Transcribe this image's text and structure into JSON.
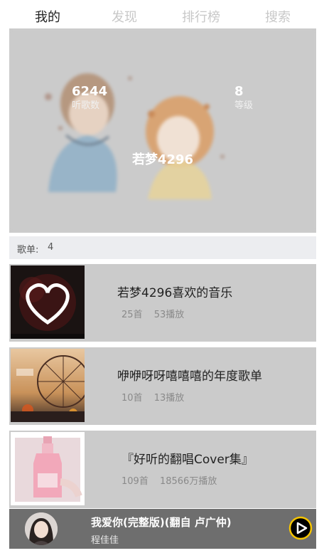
{
  "tabs": [
    {
      "label": "我的",
      "active": true
    },
    {
      "label": "发现",
      "active": false
    },
    {
      "label": "排行榜",
      "active": false
    },
    {
      "label": "搜索",
      "active": false
    }
  ],
  "profile": {
    "listen_count": "6244",
    "listen_label": "听歌数",
    "level": "8",
    "level_label": "等级",
    "username": "若梦4296"
  },
  "section": {
    "label": "歌单:",
    "count": "4"
  },
  "playlists": [
    {
      "title": "若梦4296喜欢的音乐",
      "tracks": "25首",
      "plays": "53播放",
      "cover_icon": "heart-icon"
    },
    {
      "title": "咿咿呀呀嘻嘻嘻的年度歌单",
      "tracks": "10首",
      "plays": "13播放",
      "cover_icon": "ferris-wheel-photo"
    },
    {
      "title": "『好听的翻唱Cover集』",
      "tracks": "109首",
      "plays": "18566万播放",
      "cover_icon": "pink-bottle-photo"
    }
  ],
  "player": {
    "song": "我爱你(完整版)(翻自 卢广仲)",
    "artist": "程佳佳",
    "play_icon": "play-icon"
  },
  "colors": {
    "banner_bg": "#cbcbcb",
    "item_bg": "#cbcbcb",
    "player_bg": "#6e6e6e",
    "play_ring": "#f5c400"
  }
}
